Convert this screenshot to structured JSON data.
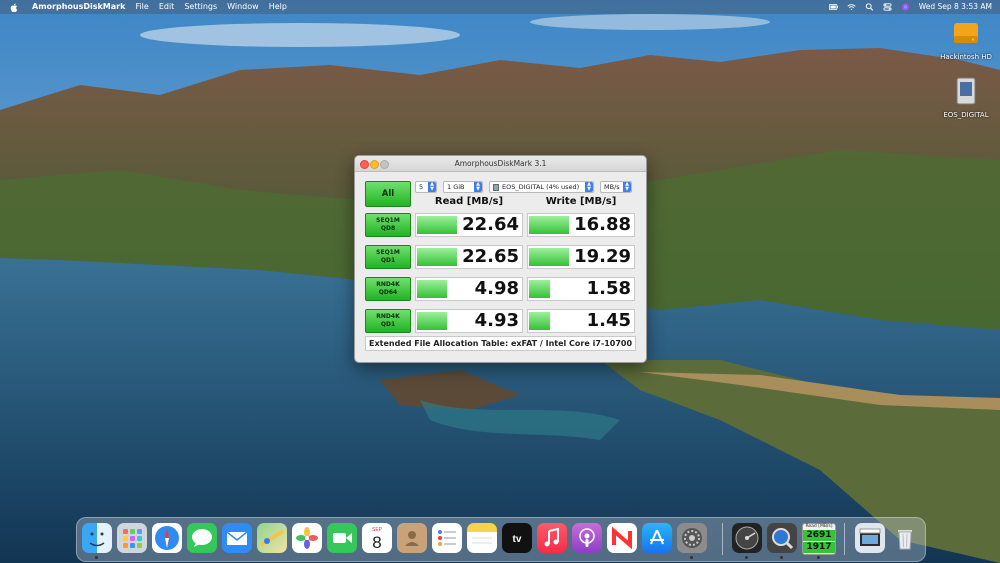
{
  "menubar": {
    "app_name": "AmorphousDiskMark",
    "menus": [
      "File",
      "Edit",
      "Settings",
      "Window",
      "Help"
    ],
    "clock": "Wed Sep 8  3:53 AM"
  },
  "desktop_icons": [
    {
      "label": "Hackintosh HD",
      "icon": "hard-drive-icon"
    },
    {
      "label": "EOS_DIGITAL",
      "icon": "sd-card-icon"
    }
  ],
  "window": {
    "title": "AmorphousDiskMark 3.1",
    "controls": {
      "count": "5",
      "size": "1 GiB",
      "drive": "EOS_DIGITAL (4% used)",
      "unit": "MB/s"
    },
    "all_button": "All",
    "read_header": "Read [MB/s]",
    "write_header": "Write [MB/s]",
    "rows": [
      {
        "l1": "SEQ1M",
        "l2": "QD8",
        "read": "22.64",
        "write": "16.88",
        "read_frac": 0.38,
        "write_frac": 0.38
      },
      {
        "l1": "SEQ1M",
        "l2": "QD1",
        "read": "22.65",
        "write": "19.29",
        "read_frac": 0.38,
        "write_frac": 0.38
      },
      {
        "l1": "RND4K",
        "l2": "QD64",
        "read": "4.98",
        "write": "1.58",
        "read_frac": 0.28,
        "write_frac": 0.2
      },
      {
        "l1": "RND4K",
        "l2": "QD1",
        "read": "4.93",
        "write": "1.45",
        "read_frac": 0.28,
        "write_frac": 0.2
      }
    ],
    "footer": "Extended File Allocation Table: exFAT / Intel Core i7-10700"
  },
  "dock": {
    "items": [
      "Finder",
      "Launchpad",
      "Safari",
      "Messages",
      "Mail",
      "Maps",
      "Photos",
      "FaceTime",
      "Calendar",
      "Contacts",
      "Reminders",
      "Notes",
      "TV",
      "Music",
      "Podcasts",
      "News",
      "App Store",
      "System Preferences",
      "Disk Utility",
      "Quick Look",
      "AmorphousDiskMark",
      "Downloads",
      "Trash"
    ],
    "calendar_month": "SEP",
    "calendar_day": "8",
    "tv_label": "tv",
    "mini_monitor": {
      "title": "Read [MB/s]",
      "read": "2691",
      "write": "1917"
    }
  },
  "colors": {
    "accent_green": "#22b322",
    "select_blue": "#3b7ff0"
  }
}
